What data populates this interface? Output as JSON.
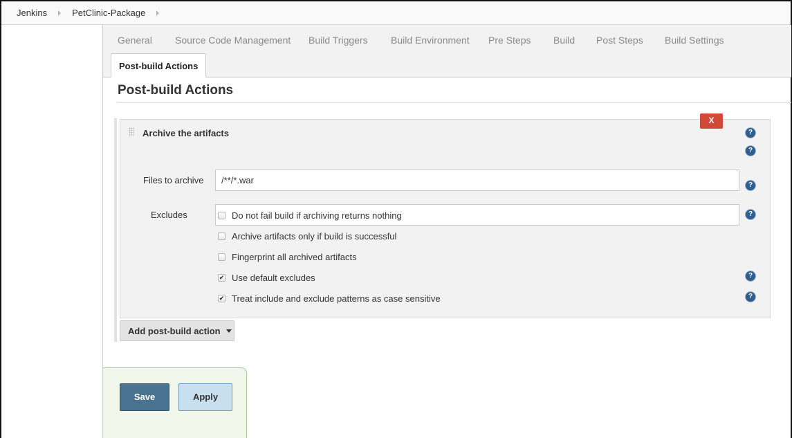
{
  "breadcrumb": {
    "items": [
      "Jenkins",
      "PetClinic-Package"
    ]
  },
  "tabs": [
    "General",
    "Source Code Management",
    "Build Triggers",
    "Build Environment",
    "Pre Steps",
    "Build",
    "Post Steps",
    "Build Settings",
    "Post-build Actions"
  ],
  "active_tab": "Post-build Actions",
  "section_title": "Post-build Actions",
  "step": {
    "title": "Archive the artifacts",
    "delete_label": "X",
    "files_label": "Files to archive",
    "files_value": "/**/*.war",
    "excludes_label": "Excludes",
    "excludes_value": "",
    "options": [
      {
        "label": "Do not fail build if archiving returns nothing",
        "checked": false,
        "mark": ""
      },
      {
        "label": "Archive artifacts only if build is successful",
        "checked": false,
        "mark": ""
      },
      {
        "label": "Fingerprint all archived artifacts",
        "checked": false,
        "mark": ""
      },
      {
        "label": "Use default excludes",
        "checked": true,
        "mark": "✔"
      },
      {
        "label": "Treat include and exclude patterns as case sensitive",
        "checked": true,
        "mark": "✔"
      }
    ]
  },
  "help_glyph": "?",
  "add_action_label": "Add post-build action",
  "buttons": {
    "save": "Save",
    "apply": "Apply"
  },
  "colors": {
    "delete": "#d24939",
    "save": "#4a7391",
    "apply": "#c8dff0",
    "help": "#2f5e8f"
  }
}
